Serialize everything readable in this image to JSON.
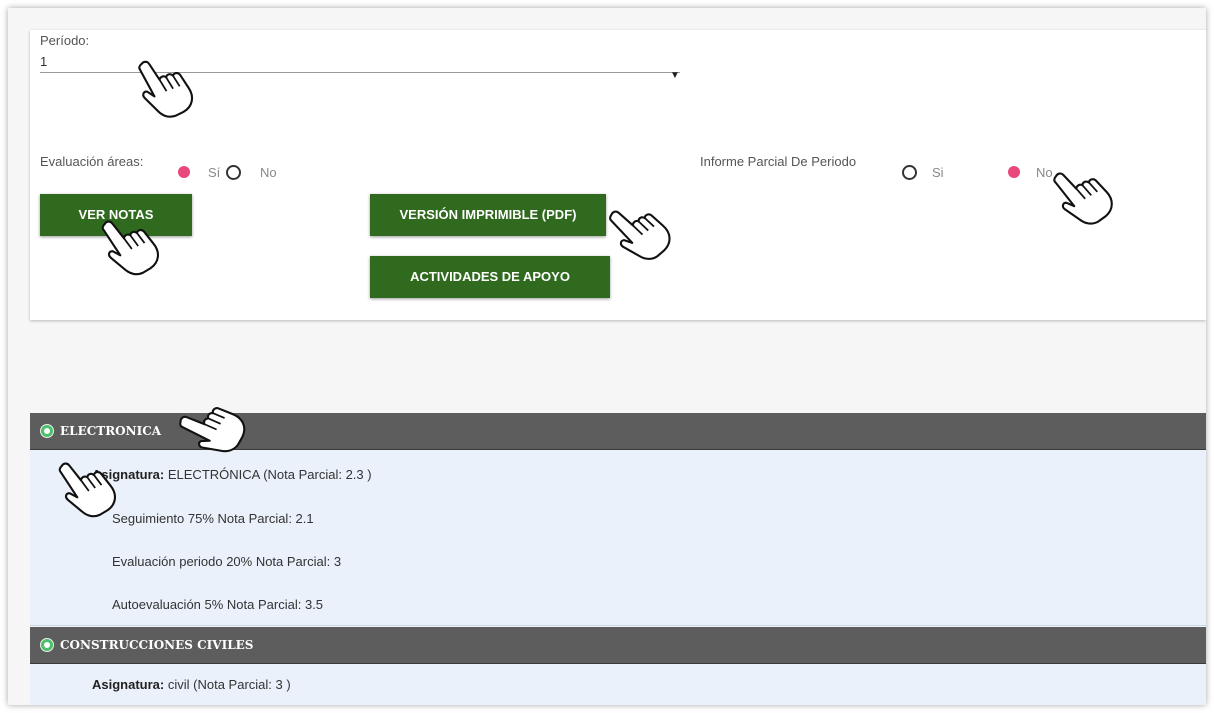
{
  "filters": {
    "periodo_label": "Período:",
    "periodo_value": "1",
    "evaluacion_areas_label": "Evaluación áreas:",
    "evaluacion_si": "Sí",
    "evaluacion_no": "No",
    "informe_label": "Informe Parcial De Periodo",
    "informe_si": "Si",
    "informe_no": "No"
  },
  "buttons": {
    "ver_notas": "VER NOTAS",
    "version_imprimible": "VERSIÓN IMPRIMIBLE (PDF)",
    "actividades_apoyo": "ACTIVIDADES DE APOYO"
  },
  "sections": [
    {
      "title": "ELECTRONICA",
      "asignatura_label": "Asignatura:",
      "asignatura_value": "ELECTRÓNICA (Nota Parcial: 2.3 )",
      "items": [
        "Seguimiento 75% Nota Parcial: 2.1",
        "Evaluación periodo 20% Nota Parcial: 3",
        "Autoevaluación 5% Nota Parcial: 3.5"
      ]
    },
    {
      "title": "CONSTRUCCIONES CIVILES",
      "asignatura_label": "Asignatura:",
      "asignatura_value": "civil (Nota Parcial: 3 )"
    }
  ],
  "colors": {
    "button_green": "#2f6a1e",
    "radio_selected": "#e8497a",
    "section_header": "#5d5d5d",
    "section_body": "#eaf1fb"
  },
  "icons": [
    "pointing-hand-icon",
    "expand-circle-icon"
  ]
}
